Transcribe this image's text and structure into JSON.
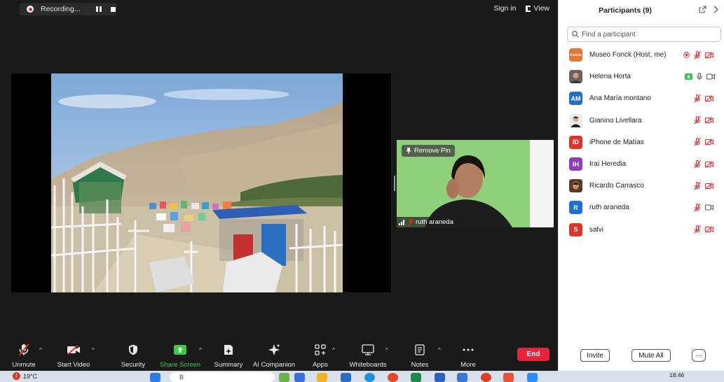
{
  "recording": {
    "label": "Recording..."
  },
  "topbar": {
    "sign_in": "Sign in",
    "view": "View"
  },
  "share": {
    "remove_pin": "Remove Pin"
  },
  "active_speaker": {
    "name": "ruth araneda"
  },
  "toolbar": {
    "unmute": "Unmute",
    "start_video": "Start Video",
    "security": "Security",
    "share_screen": "Share Screen",
    "summary": "Summary",
    "ai_companion": "AI Companion",
    "apps": "Apps",
    "whiteboards": "Whiteboards",
    "notes": "Notes",
    "more": "More",
    "end": "End"
  },
  "panel": {
    "title": "Participants (9)",
    "search_placeholder": "Find a participant",
    "participants": [
      {
        "name": "Museo Fonck (Host, me)",
        "initials": "FONCK",
        "color": "#e07a3a"
      },
      {
        "name": "Helena Horta",
        "initials": "",
        "color": "#8a7a6a"
      },
      {
        "name": "Ana María montano",
        "initials": "AM",
        "color": "#1f6fd1"
      },
      {
        "name": "Gianino Livellara",
        "initials": "",
        "color": "#c8a080"
      },
      {
        "name": "iPhone de Matías",
        "initials": "ID",
        "color": "#d8382c"
      },
      {
        "name": "Iraí Heredia",
        "initials": "IH",
        "color": "#8e3fb8"
      },
      {
        "name": "Ricardo Carrasco",
        "initials": "",
        "color": "#8a5a3a"
      },
      {
        "name": "ruth araneda",
        "initials": "R",
        "color": "#1f6fd1"
      },
      {
        "name": "salvi",
        "initials": "S",
        "color": "#d8382c"
      }
    ],
    "invite": "Invite",
    "mute_all": "Mute All",
    "more": "···"
  },
  "taskbar": {
    "weather_badge": "1",
    "temperature": "19°C",
    "search_text": "B",
    "time": "18:46"
  },
  "colors": {
    "muted_red": "#e02828",
    "accent_green": "#3cc84a",
    "end_red": "#e5243b"
  }
}
